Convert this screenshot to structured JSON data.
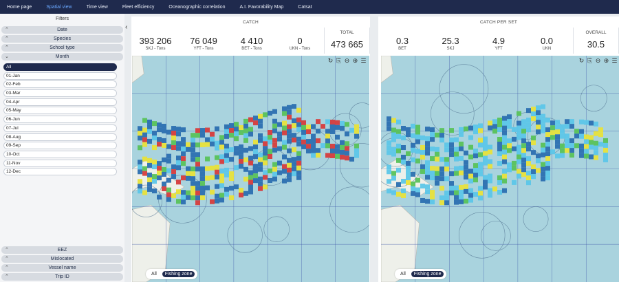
{
  "nav": {
    "items": [
      "Home page",
      "Spatial view",
      "Time view",
      "Fleet efficiency",
      "Oceanographic correlation",
      "A.I. Favorability Map",
      "Catsat"
    ],
    "active_index": 1
  },
  "sidebar": {
    "title": "Filters",
    "top_sections": [
      "Date",
      "Species",
      "School type",
      "Month"
    ],
    "months": [
      "All",
      "01-Jan",
      "02-Feb",
      "03-Mar",
      "04-Apr",
      "05-May",
      "06-Jun",
      "07-Jul",
      "08-Aug",
      "09-Sep",
      "10-Oct",
      "11-Nov",
      "12-Dec"
    ],
    "selected_month": "All",
    "bottom_sections": [
      "EEZ",
      "Mislocated",
      "Vessel name",
      "Trip ID"
    ]
  },
  "collapse_icon": "chevron-left-icon",
  "catch_panel": {
    "title": "CATCH",
    "kpis": [
      {
        "value": "393 206",
        "label": "SKJ - Tons"
      },
      {
        "value": "76 049",
        "label": "YFT - Tons"
      },
      {
        "value": "4 410",
        "label": "BET - Tons"
      },
      {
        "value": "0",
        "label": "UKN - Tons"
      }
    ],
    "total_label": "TOTAL",
    "total_value": "473 665",
    "toggle": {
      "all": "All",
      "zone": "Fishing zone"
    }
  },
  "cps_panel": {
    "title": "CATCH PER SET",
    "kpis": [
      {
        "value": "0.3",
        "label": "BET"
      },
      {
        "value": "25.3",
        "label": "SKJ"
      },
      {
        "value": "4.9",
        "label": "YFT"
      },
      {
        "value": "0.0",
        "label": "UKN"
      }
    ],
    "total_label": "OVERALL",
    "total_value": "30.5",
    "toggle": {
      "all": "All",
      "zone": "Fishing zone"
    }
  },
  "map_tools": [
    "refresh-icon",
    "bookmark-icon",
    "zoom-out-icon",
    "zoom-in-icon",
    "layers-icon"
  ],
  "colors": {
    "nav_bg": "#1f2a4d",
    "nav_active": "#6aa8ff",
    "ocean": "#a9d3de",
    "land": "#eef0ea",
    "heat_low": "#2b6fb0",
    "heat_mid": "#5cc6e8",
    "heat_green": "#58c25a",
    "heat_yellow": "#e8e23a",
    "heat_red": "#d63c3c"
  }
}
